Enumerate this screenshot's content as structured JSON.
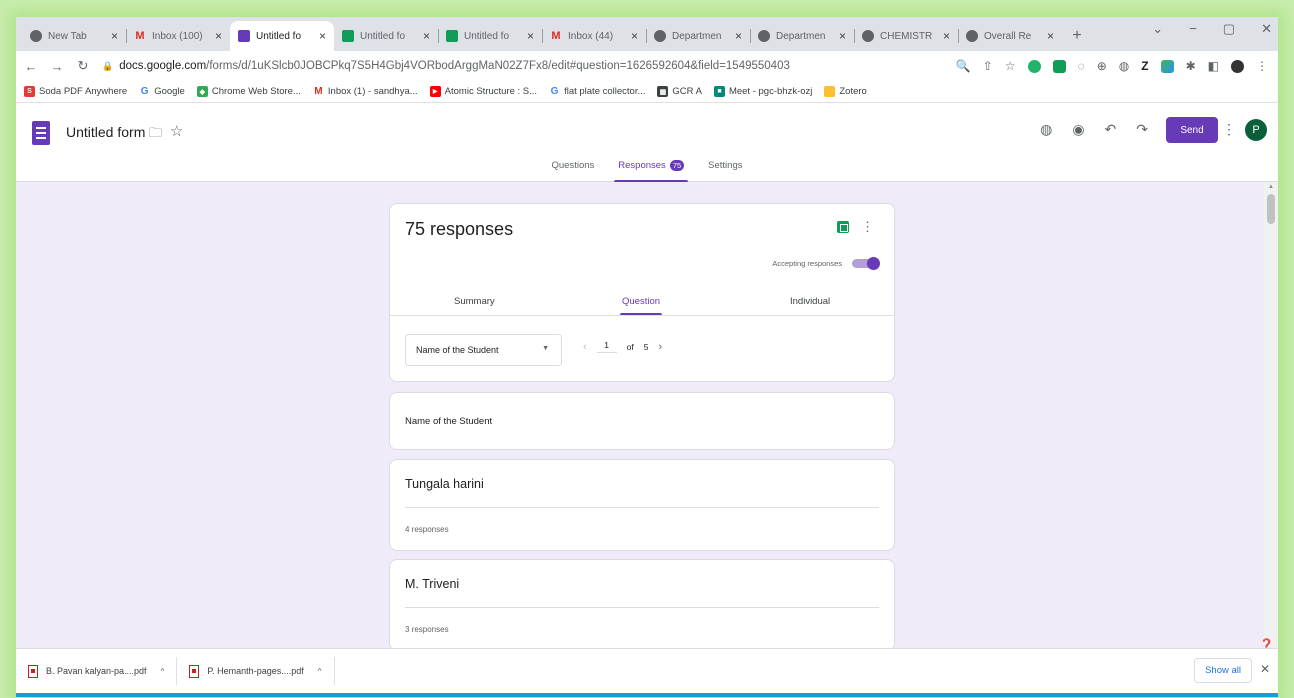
{
  "browser": {
    "tabs": [
      {
        "icon": "globe-icon",
        "label": "New Tab",
        "active": false
      },
      {
        "icon": "gmail-icon",
        "label": "Inbox (100)",
        "active": false
      },
      {
        "icon": "forms-icon",
        "label": "Untitled fo",
        "active": true
      },
      {
        "icon": "sheets-icon",
        "label": "Untitled fo",
        "active": false
      },
      {
        "icon": "sheets-icon",
        "label": "Untitled fo",
        "active": false
      },
      {
        "icon": "gmail-icon",
        "label": "Inbox (44)",
        "active": false
      },
      {
        "icon": "globe-icon",
        "label": "Departmen",
        "active": false
      },
      {
        "icon": "globe-icon",
        "label": "Departmen",
        "active": false
      },
      {
        "icon": "globe-icon",
        "label": "CHEMISTR",
        "active": false
      },
      {
        "icon": "globe-icon",
        "label": "Overall Re",
        "active": false
      }
    ],
    "url_host": "docs.google.com",
    "url_path": "/forms/d/1uKSlcb0JOBCPkq7S5H4Gbj4VORbodArggMaN02Z7Fx8/edit#question=1626592604&field=1549550403",
    "bookmarks": [
      {
        "label": "Soda PDF Anywhere",
        "color": "#e53935",
        "glyph": "S"
      },
      {
        "label": "Google",
        "color": "#4285f4",
        "glyph": "G"
      },
      {
        "label": "Chrome Web Store...",
        "color": "#34a853",
        "glyph": "◆"
      },
      {
        "label": "Inbox (1) - sandhya...",
        "color": "#d93025",
        "glyph": "M"
      },
      {
        "label": "Atomic Structure : S...",
        "color": "#ff0000",
        "glyph": "▶"
      },
      {
        "label": "flat plate collector...",
        "color": "#4285f4",
        "glyph": "G"
      },
      {
        "label": "GCR A",
        "color": "#3c4043",
        "glyph": "▦"
      },
      {
        "label": "Meet - pgc-bhzk-ozj",
        "color": "#00897b",
        "glyph": "■"
      },
      {
        "label": "Zotero",
        "color": "#fbc02d",
        "glyph": "Z"
      }
    ]
  },
  "form": {
    "title": "Untitled form",
    "send_label": "Send",
    "avatar_letter": "P",
    "tabs": {
      "questions": "Questions",
      "responses": "Responses",
      "responses_count": "75",
      "settings": "Settings"
    },
    "responses_title": "75 responses",
    "accepting_label": "Accepting responses",
    "view_tabs": {
      "summary": "Summary",
      "question": "Question",
      "individual": "Individual"
    },
    "question_select": "Name of the Student",
    "pager": {
      "current": "1",
      "of": "of",
      "total": "5"
    },
    "question_label": "Name of the Student",
    "answers": [
      {
        "text": "Tungala harini",
        "count": "4 responses"
      },
      {
        "text": "M. Triveni",
        "count": "3 responses"
      }
    ]
  },
  "downloads": {
    "items": [
      {
        "label": "B. Pavan kalyan-pa....pdf"
      },
      {
        "label": "P. Hemanth-pages....pdf"
      }
    ],
    "show_all": "Show all"
  }
}
